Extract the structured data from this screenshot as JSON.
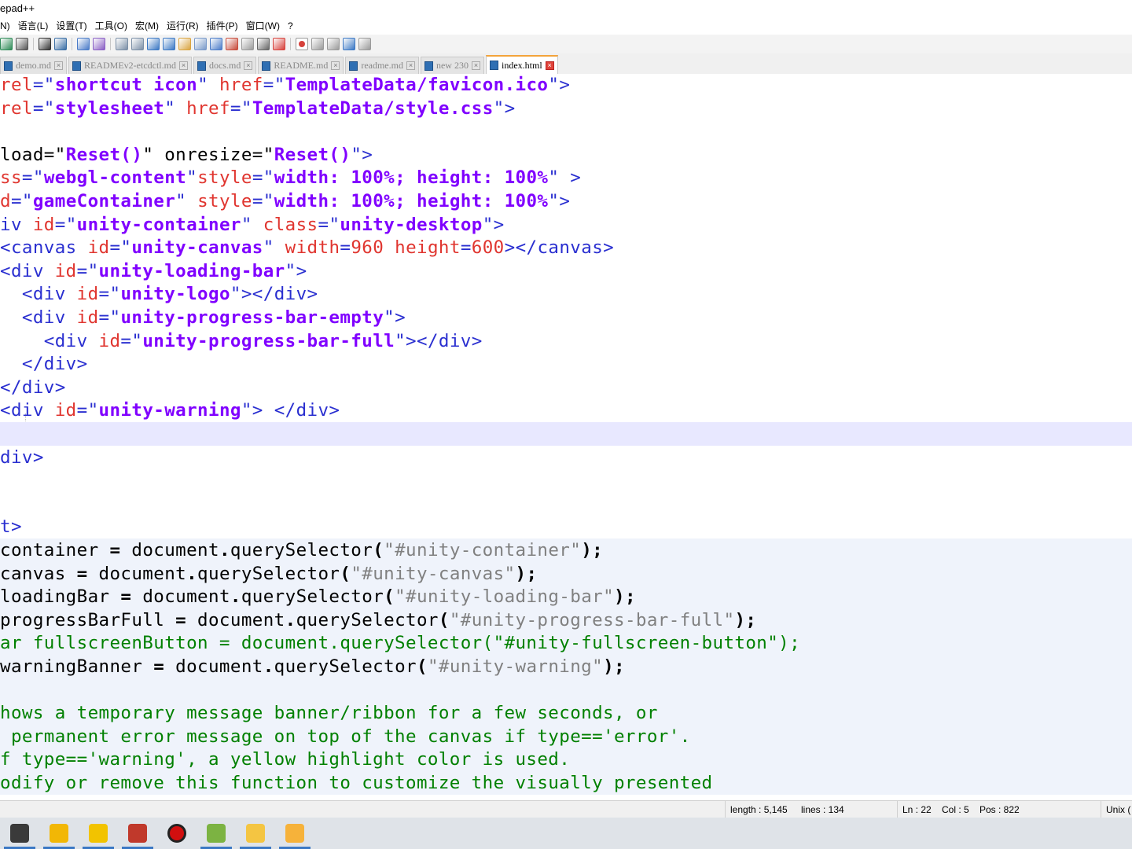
{
  "window": {
    "title": "epad++"
  },
  "menu": [
    "N)",
    "语言(L)",
    "设置(T)",
    "工具(O)",
    "宏(M)",
    "运行(R)",
    "插件(P)",
    "窗口(W)",
    "?"
  ],
  "toolbar_icons": [
    "redo-icon",
    "undo-icon",
    "find-icon",
    "replace-icon",
    "zoom-in-icon",
    "zoom-out-icon",
    "sync-v-icon",
    "sync-h-icon",
    "wrap-icon",
    "show-all-chars-icon",
    "indent-guide-icon",
    "udl-icon",
    "doc-map-icon",
    "func-list-icon",
    "folder-workspace-icon",
    "monitor-icon",
    "preview-icon",
    "record-macro-icon",
    "stop-record-icon",
    "play-macro-icon",
    "run-macro-multiple-icon",
    "save-macro-icon"
  ],
  "tabs": [
    {
      "label": "demo.md"
    },
    {
      "label": "READMEv2-etcdctl.md"
    },
    {
      "label": "docs.md"
    },
    {
      "label": "README.md"
    },
    {
      "label": "readme.md"
    },
    {
      "label": "new 230"
    },
    {
      "label": "index.html",
      "active": true
    }
  ],
  "code": [
    [
      [
        "a",
        "rel"
      ],
      [
        "t",
        "=\""
      ],
      [
        "v",
        "shortcut icon"
      ],
      [
        "t",
        "\" "
      ],
      [
        "a",
        "href"
      ],
      [
        "t",
        "=\""
      ],
      [
        "v",
        "TemplateData/favicon.ico"
      ],
      [
        "t",
        "\">"
      ]
    ],
    [
      [
        "a",
        "rel"
      ],
      [
        "t",
        "=\""
      ],
      [
        "v",
        "stylesheet"
      ],
      [
        "t",
        "\" "
      ],
      [
        "a",
        "href"
      ],
      [
        "t",
        "=\""
      ],
      [
        "v",
        "TemplateData/style.css"
      ],
      [
        "t",
        "\">"
      ]
    ],
    [],
    [
      [
        "p",
        "load"
      ],
      [
        "p",
        "=\""
      ],
      [
        "v",
        "Reset()"
      ],
      [
        "p",
        "\" onresize"
      ],
      [
        "p",
        "=\""
      ],
      [
        "v",
        "Reset()"
      ],
      [
        "t",
        "\">"
      ]
    ],
    [
      [
        "a",
        "ss"
      ],
      [
        "t",
        "=\""
      ],
      [
        "v",
        "webgl-content"
      ],
      [
        "t",
        "\""
      ],
      [
        "a",
        "style"
      ],
      [
        "t",
        "=\""
      ],
      [
        "v",
        "width: 100%; height: 100%"
      ],
      [
        "t",
        "\" >"
      ]
    ],
    [
      [
        "a",
        "d"
      ],
      [
        "t",
        "=\""
      ],
      [
        "v",
        "gameContainer"
      ],
      [
        "t",
        "\" "
      ],
      [
        "a",
        "style"
      ],
      [
        "t",
        "=\""
      ],
      [
        "v",
        "width: 100%; height: 100%"
      ],
      [
        "t",
        "\">"
      ]
    ],
    [
      [
        "t",
        "iv "
      ],
      [
        "a",
        "id"
      ],
      [
        "t",
        "=\""
      ],
      [
        "v",
        "unity-container"
      ],
      [
        "t",
        "\" "
      ],
      [
        "a",
        "class"
      ],
      [
        "t",
        "=\""
      ],
      [
        "v",
        "unity-desktop"
      ],
      [
        "t",
        "\">"
      ]
    ],
    [
      [
        "t",
        "<canvas "
      ],
      [
        "a",
        "id"
      ],
      [
        "t",
        "=\""
      ],
      [
        "v",
        "unity-canvas"
      ],
      [
        "t",
        "\" "
      ],
      [
        "a",
        "width"
      ],
      [
        "t",
        "="
      ],
      [
        "a",
        "960"
      ],
      [
        "t",
        " "
      ],
      [
        "a",
        "height"
      ],
      [
        "t",
        "="
      ],
      [
        "a",
        "600"
      ],
      [
        "t",
        "></canvas>"
      ]
    ],
    [
      [
        "t",
        "<div "
      ],
      [
        "a",
        "id"
      ],
      [
        "t",
        "=\""
      ],
      [
        "v",
        "unity-loading-bar"
      ],
      [
        "t",
        "\">"
      ]
    ],
    [
      [
        "t",
        "  <div "
      ],
      [
        "a",
        "id"
      ],
      [
        "t",
        "=\""
      ],
      [
        "v",
        "unity-logo"
      ],
      [
        "t",
        "\"></div>"
      ]
    ],
    [
      [
        "t",
        "  <div "
      ],
      [
        "a",
        "id"
      ],
      [
        "t",
        "=\""
      ],
      [
        "v",
        "unity-progress-bar-empty"
      ],
      [
        "t",
        "\">"
      ]
    ],
    [
      [
        "t",
        "    <div "
      ],
      [
        "a",
        "id"
      ],
      [
        "t",
        "=\""
      ],
      [
        "v",
        "unity-progress-bar-full"
      ],
      [
        "t",
        "\"></div>"
      ]
    ],
    [
      [
        "t",
        "  </div>"
      ]
    ],
    [
      [
        "t",
        "</div>"
      ]
    ],
    [
      [
        "t",
        "<div "
      ],
      [
        "a",
        "id"
      ],
      [
        "t",
        "=\""
      ],
      [
        "v",
        "unity-warning"
      ],
      [
        "t",
        "\"> </div>"
      ]
    ],
    [],
    [
      [
        "t",
        "div>"
      ]
    ],
    [],
    [],
    [
      [
        "t",
        "t>"
      ]
    ],
    [
      [
        "p",
        "container "
      ],
      [
        "o",
        "="
      ],
      [
        "p",
        " document"
      ],
      [
        "o",
        "."
      ],
      [
        "p",
        "querySelector"
      ],
      [
        "o",
        "("
      ],
      [
        "s",
        "\"#unity-container\""
      ],
      [
        "o",
        ");"
      ]
    ],
    [
      [
        "p",
        "canvas "
      ],
      [
        "o",
        "="
      ],
      [
        "p",
        " document"
      ],
      [
        "o",
        "."
      ],
      [
        "p",
        "querySelector"
      ],
      [
        "o",
        "("
      ],
      [
        "s",
        "\"#unity-canvas\""
      ],
      [
        "o",
        ");"
      ]
    ],
    [
      [
        "p",
        "loadingBar "
      ],
      [
        "o",
        "="
      ],
      [
        "p",
        " document"
      ],
      [
        "o",
        "."
      ],
      [
        "p",
        "querySelector"
      ],
      [
        "o",
        "("
      ],
      [
        "s",
        "\"#unity-loading-bar\""
      ],
      [
        "o",
        ");"
      ]
    ],
    [
      [
        "p",
        "progressBarFull "
      ],
      [
        "o",
        "="
      ],
      [
        "p",
        " document"
      ],
      [
        "o",
        "."
      ],
      [
        "p",
        "querySelector"
      ],
      [
        "o",
        "("
      ],
      [
        "s",
        "\"#unity-progress-bar-full\""
      ],
      [
        "o",
        ");"
      ]
    ],
    [
      [
        "c",
        "ar fullscreenButton = document.querySelector(\"#unity-fullscreen-button\");"
      ]
    ],
    [
      [
        "p",
        "warningBanner "
      ],
      [
        "o",
        "="
      ],
      [
        "p",
        " document"
      ],
      [
        "o",
        "."
      ],
      [
        "p",
        "querySelector"
      ],
      [
        "o",
        "("
      ],
      [
        "s",
        "\"#unity-warning\""
      ],
      [
        "o",
        ");"
      ]
    ],
    [],
    [
      [
        "c",
        "hows a temporary message banner/ribbon for a few seconds, or"
      ]
    ],
    [
      [
        "c",
        " permanent error message on top of the canvas if type=='error'."
      ]
    ],
    [
      [
        "c",
        "f type=='warning', a yellow highlight color is used."
      ]
    ],
    [
      [
        "c",
        "odify or remove this function to customize the visually presented"
      ]
    ]
  ],
  "current_line_index": 15,
  "script_block_start": 20,
  "status": {
    "length": "length : 5,145",
    "lines": "lines : 134",
    "ln": "Ln : 22",
    "col": "Col : 5",
    "pos": "Pos : 822",
    "eol": "Unix ("
  },
  "taskbar": [
    {
      "name": "unity-hub-icon",
      "color": "#3a3a3a",
      "active": true
    },
    {
      "name": "camera-app-icon",
      "color": "#f2b705",
      "active": true
    },
    {
      "name": "postman-icon",
      "color": "#f2c300",
      "active": true
    },
    {
      "name": "rider-icon",
      "color": "#c0392b",
      "active": true
    },
    {
      "name": "obs-record-icon",
      "color": "#d10f0f",
      "active": false
    },
    {
      "name": "notepad-plus-plus-icon",
      "color": "#7cb342",
      "active": true
    },
    {
      "name": "file-explorer-icon",
      "color": "#f4c542",
      "active": true
    },
    {
      "name": "sticky-app-icon",
      "color": "#f6b23a",
      "active": true
    }
  ]
}
